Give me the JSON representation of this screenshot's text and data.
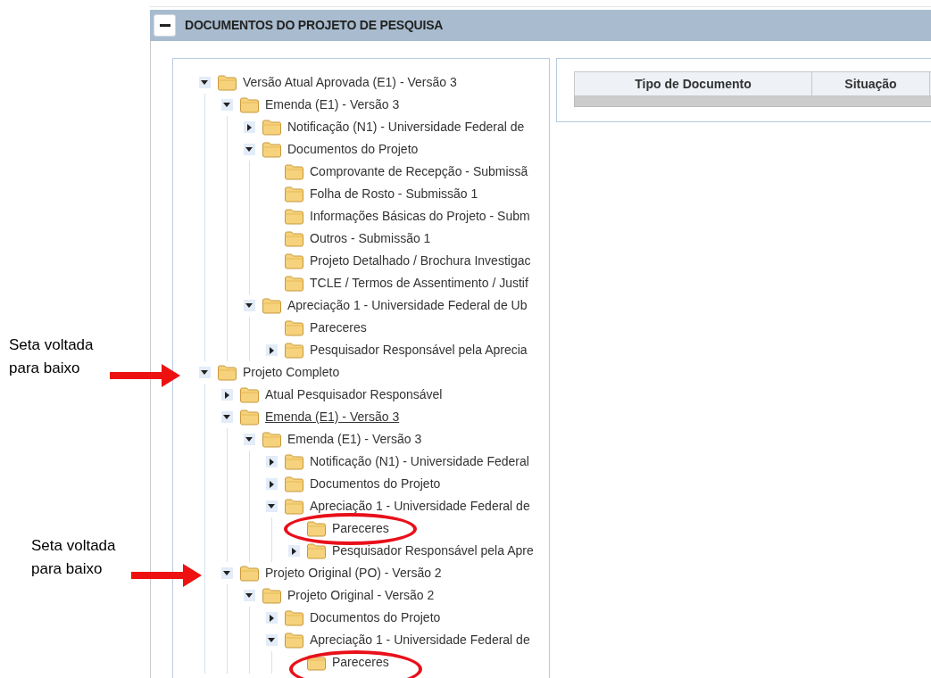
{
  "panel": {
    "title": "DOCUMENTOS DO PROJETO DE PESQUISA",
    "expanded": true
  },
  "tree": [
    {
      "label": "Versão Atual Aprovada (E1) - Versão 3",
      "expanded": true,
      "hovered": false,
      "children": [
        {
          "label": "Emenda (E1) - Versão 3",
          "expanded": true,
          "hovered": false,
          "children": [
            {
              "label": "Notificação (N1) - Universidade Federal de",
              "expanded": false,
              "hovered": false
            },
            {
              "label": "Documentos do Projeto",
              "expanded": true,
              "hovered": false,
              "children": [
                {
                  "label": "Comprovante de Recepção - Submissã",
                  "hovered": false
                },
                {
                  "label": "Folha de Rosto - Submissão 1",
                  "hovered": false
                },
                {
                  "label": "Informações Básicas do Projeto - Subm",
                  "hovered": false
                },
                {
                  "label": "Outros - Submissão 1",
                  "hovered": false
                },
                {
                  "label": "Projeto Detalhado / Brochura Investigac",
                  "hovered": false
                },
                {
                  "label": "TCLE / Termos de Assentimento / Justif",
                  "hovered": false
                }
              ]
            },
            {
              "label": "Apreciação 1 - Universidade Federal de Ub",
              "expanded": true,
              "hovered": false,
              "children": [
                {
                  "label": "Pareceres",
                  "hovered": false
                },
                {
                  "label": "Pesquisador Responsável pela Aprecia",
                  "expanded": false,
                  "hovered": false
                }
              ]
            }
          ]
        }
      ]
    },
    {
      "label": "Projeto Completo",
      "expanded": true,
      "hovered": false,
      "children": [
        {
          "label": "Atual Pesquisador Responsável",
          "expanded": false,
          "hovered": false
        },
        {
          "label": "Emenda (E1) - Versão 3",
          "expanded": true,
          "hovered": true,
          "children": [
            {
              "label": "Emenda (E1) - Versão 3",
              "expanded": true,
              "hovered": false,
              "children": [
                {
                  "label": "Notificação (N1) - Universidade Federal",
                  "expanded": false,
                  "hovered": false
                },
                {
                  "label": "Documentos do Projeto",
                  "expanded": false,
                  "hovered": false
                },
                {
                  "label": "Apreciação 1 - Universidade Federal de",
                  "expanded": true,
                  "hovered": false,
                  "children": [
                    {
                      "label": "Pareceres",
                      "hovered": false
                    },
                    {
                      "label": "Pesquisador Responsável pela Apre",
                      "expanded": false,
                      "hovered": false
                    }
                  ]
                }
              ]
            }
          ]
        },
        {
          "label": "Projeto Original (PO) - Versão 2",
          "expanded": true,
          "hovered": false,
          "children": [
            {
              "label": "Projeto Original - Versão 2",
              "expanded": true,
              "hovered": false,
              "children": [
                {
                  "label": "Documentos do Projeto",
                  "expanded": false,
                  "hovered": false
                },
                {
                  "label": "Apreciação 1 - Universidade Federal de",
                  "expanded": true,
                  "hovered": false,
                  "children": [
                    {
                      "label": "Pareceres",
                      "hovered": false
                    }
                  ]
                }
              ]
            }
          ]
        }
      ]
    }
  ],
  "table": {
    "columns": [
      "Tipo de Documento",
      "Situação"
    ]
  },
  "annotations": [
    {
      "kind": "arrow-callout",
      "lines": [
        "Seta voltada",
        "para baixo"
      ]
    },
    {
      "kind": "arrow-callout",
      "lines": [
        "Seta voltada",
        "para baixo"
      ]
    },
    {
      "kind": "ellipse"
    },
    {
      "kind": "ellipse"
    }
  ]
}
